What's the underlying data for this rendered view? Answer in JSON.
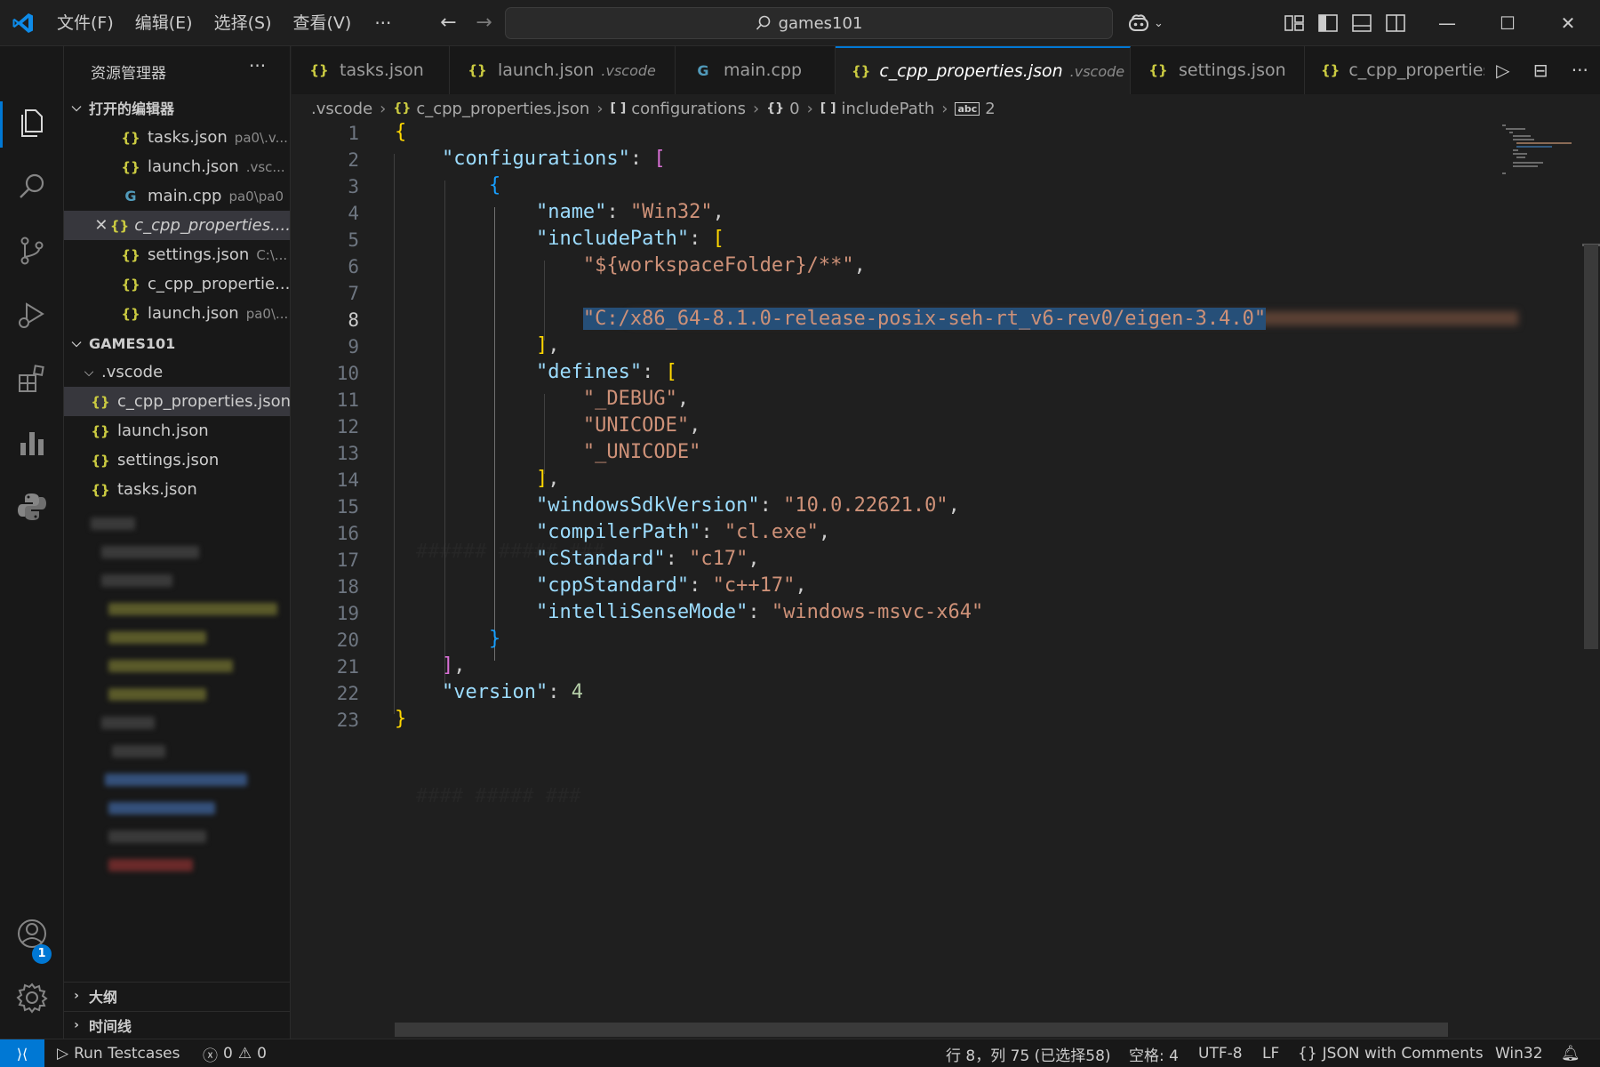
{
  "titlebar": {
    "menus": [
      "文件(F)",
      "编辑(E)",
      "选择(S)",
      "查看(V)"
    ],
    "more": "···",
    "search_text": "games101"
  },
  "sidebar": {
    "title": "资源管理器",
    "more": "···",
    "open_editors_header": "打开的编辑器",
    "open_editors": [
      {
        "name": "tasks.json",
        "desc": "pa0\\.v...",
        "icon": "json"
      },
      {
        "name": "launch.json",
        "desc": ".vsc...",
        "icon": "json"
      },
      {
        "name": "main.cpp",
        "desc": "pa0\\pa0",
        "icon": "cpp"
      },
      {
        "name": "c_cpp_properties....",
        "desc": "",
        "icon": "json"
      },
      {
        "name": "settings.json",
        "desc": "C:\\...",
        "icon": "json"
      },
      {
        "name": "c_cpp_propertie...",
        "desc": "",
        "icon": "json"
      },
      {
        "name": "launch.json",
        "desc": "pa0\\...",
        "icon": "json"
      }
    ],
    "workspace_header": "GAMES101",
    "vscode_folder": ".vscode",
    "vscode_files": [
      "c_cpp_properties.json",
      "launch.json",
      "settings.json",
      "tasks.json"
    ],
    "outline_header": "大纲",
    "timeline_header": "时间线",
    "json_icon_glyph": "{}",
    "cpp_icon_glyph": "G",
    "close_glyph": "✕"
  },
  "tabs": [
    {
      "name": "tasks.json",
      "desc": ""
    },
    {
      "name": "launch.json",
      "desc": ".vscode"
    },
    {
      "name": "main.cpp",
      "desc": ""
    },
    {
      "name": "c_cpp_properties.json",
      "desc": ".vscode"
    },
    {
      "name": "settings.json",
      "desc": ""
    },
    {
      "name": "c_cpp_properties.",
      "desc": ""
    }
  ],
  "breadcrumbs": {
    "items": [
      ".vscode",
      "c_cpp_properties.json",
      "configurations",
      "0",
      "includePath",
      "2"
    ],
    "array_glyph": "[ ]",
    "object_glyph": "{}",
    "string_glyph": "abc"
  },
  "editor": {
    "current_line": 8,
    "line_numbers": [
      "1",
      "2",
      "3",
      "4",
      "5",
      "6",
      "7",
      "8",
      "9",
      "10",
      "11",
      "12",
      "13",
      "14",
      "15",
      "16",
      "17",
      "18",
      "19",
      "20",
      "21",
      "22",
      "23"
    ],
    "code": {
      "l2_key": "\"configurations\"",
      "l4_key": "\"name\"",
      "l4_val": "\"Win32\"",
      "l5_key": "\"includePath\"",
      "l6_val": "\"${workspaceFolder}/**\"",
      "l8_val": "\"C:/x86_64-8.1.0-release-posix-seh-rt_v6-rev0/eigen-3.4.0\"",
      "l10_key": "\"defines\"",
      "l11_val": "\"_DEBUG\"",
      "l12_val": "\"UNICODE\"",
      "l13_val": "\"_UNICODE\"",
      "l15_key": "\"windowsSdkVersion\"",
      "l15_val": "\"10.0.22621.0\"",
      "l16_key": "\"compilerPath\"",
      "l16_val": "\"cl.exe\"",
      "l17_key": "\"cStandard\"",
      "l17_val": "\"c17\"",
      "l18_key": "\"cppStandard\"",
      "l18_val": "\"c++17\"",
      "l19_key": "\"intelliSenseMode\"",
      "l19_val": "\"windows-msvc-x64\"",
      "l22_key": "\"version\"",
      "l22_val": "4"
    }
  },
  "statusbar": {
    "run_testcases": "Run Testcases",
    "errors": "0",
    "warnings": "0",
    "cursor": "行 8，列 75 (已选择58)",
    "spaces": "空格: 4",
    "encoding": "UTF-8",
    "eol": "LF",
    "language": "JSON with Comments",
    "config": "Win32"
  },
  "colors": {
    "accent": "#0078d4",
    "json_icon": "#cbcb41",
    "key": "#9cdcfe",
    "string": "#ce9178",
    "selection": "#264f78"
  }
}
